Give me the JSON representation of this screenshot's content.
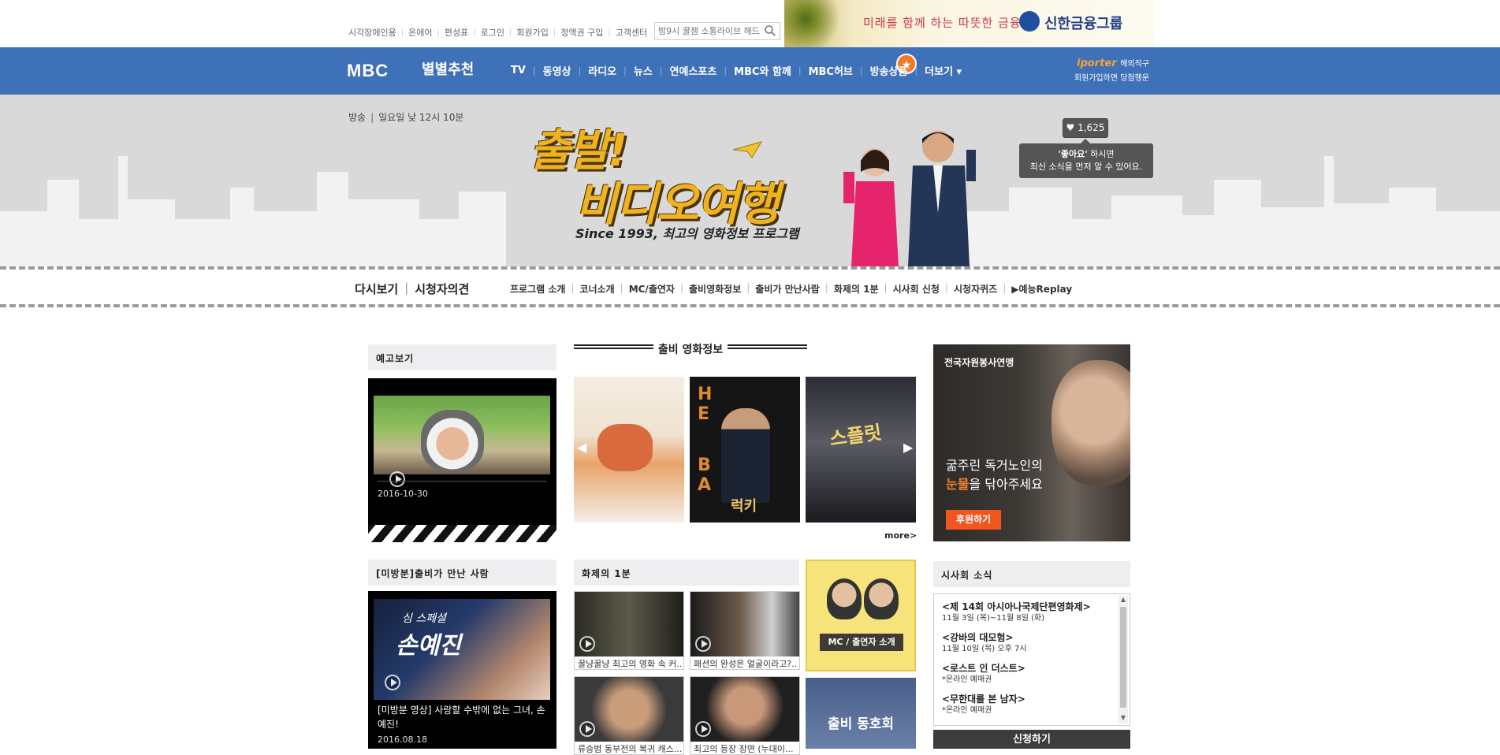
{
  "top": {
    "links": [
      "시각장애인용",
      "온에어",
      "편성표",
      "로그인",
      "회원가입",
      "정액권 구입",
      "고객센터"
    ],
    "search_placeholder": "밤9시 꿀잼 소통라이브 해드",
    "ad": {
      "slogan": "미래를 함께 하는 따뜻한 금융",
      "brand": "신한금융그룹"
    }
  },
  "gnb": {
    "logo": "MBC",
    "star_pick": "별별추천",
    "menu": [
      "TV",
      "동영상",
      "라디오",
      "뉴스",
      "연예스포츠",
      "MBC와 함께",
      "MBC허브",
      "방송상품",
      "더보기 ▾"
    ],
    "iporter": {
      "brand": "iporter",
      "tag": "해외직구",
      "sub": "회원가입하면 당첨행운"
    }
  },
  "banner": {
    "channel": "방송",
    "schedule": "일요일 낮 12시 10분",
    "title_line1": "출발!",
    "title_line2": "비디오여행",
    "subtitle": "Since 1993, 최고의 영화정보 프로그램",
    "like_count": "♥ 1,625",
    "like_tip_bold": "'좋아요'",
    "like_tip_rest": " 하시면",
    "like_tip_line2": "최신 소식을 먼저 알 수 있어요."
  },
  "subnav": {
    "left": [
      "다시보기",
      "시청자의견"
    ],
    "menu": [
      "프로그램 소개",
      "코너소개",
      "MC/출연자",
      "출비영화정보",
      "출비가 만난사람",
      "화제의 1분",
      "시사회 신청",
      "시청자퀴즈",
      "▶예능Replay"
    ]
  },
  "preview": {
    "heading": "예고보기",
    "date": "2016-10-30"
  },
  "movie_info": {
    "heading": "출비 영화정보",
    "posters": [
      {
        "title": "",
        "arrow_left": "◀",
        "arrow_right": "▶"
      },
      {
        "headline": "H E I S B A C K",
        "title": "럭키"
      },
      {
        "title": "스플릿"
      }
    ],
    "more": "more>"
  },
  "ad_right": {
    "org": "전국자원봉사연맹",
    "line1": "굶주린 독거노인의",
    "line2_highlight": "눈물",
    "line2_rest": "을 닦아주세요",
    "button": "후원하기"
  },
  "unaired": {
    "heading": "[미방분]출비가 만난 사람",
    "thumb_text1": "심 스페셜",
    "thumb_text2": "손예진",
    "title": "[미방분 영상] 사랑할 수밖에 없는 그녀, 손예진!",
    "date": "2016.08.18"
  },
  "hot_clip": {
    "heading": "화제의 1분",
    "clips": [
      {
        "caption": "꿀냥꿀냥 최고의 영화 속 커..."
      },
      {
        "caption": "패션의 완성은 얼굴이라고?..."
      },
      {
        "caption": "류승범 동부전의 복귀 캐스..."
      },
      {
        "caption": "최고의 등장 장면 (누대이..."
      }
    ],
    "mc_card": "MC / 출연자 소개",
    "alumni_card": "출비 동호회"
  },
  "screening": {
    "heading": "시사회 소식",
    "items": [
      {
        "name": "<제 14회 아시아나국제단편영화제>",
        "detail": "11월 3일 (목)~11월 8일 (화)"
      },
      {
        "name": "<강바의 대모험>",
        "detail": "11월 10일 (목) 오후 7시"
      },
      {
        "name": "<로스트 인 더스트>",
        "detail": "*온라인 예매권"
      },
      {
        "name": "<무한대를 본 남자>",
        "detail": "*온라인 예매권"
      }
    ],
    "apply": "신청하기"
  },
  "colors": {
    "gnb_bg": "#3f71b9",
    "accent_orange": "#f0561e",
    "banner_bg": "#d9d9d9"
  }
}
